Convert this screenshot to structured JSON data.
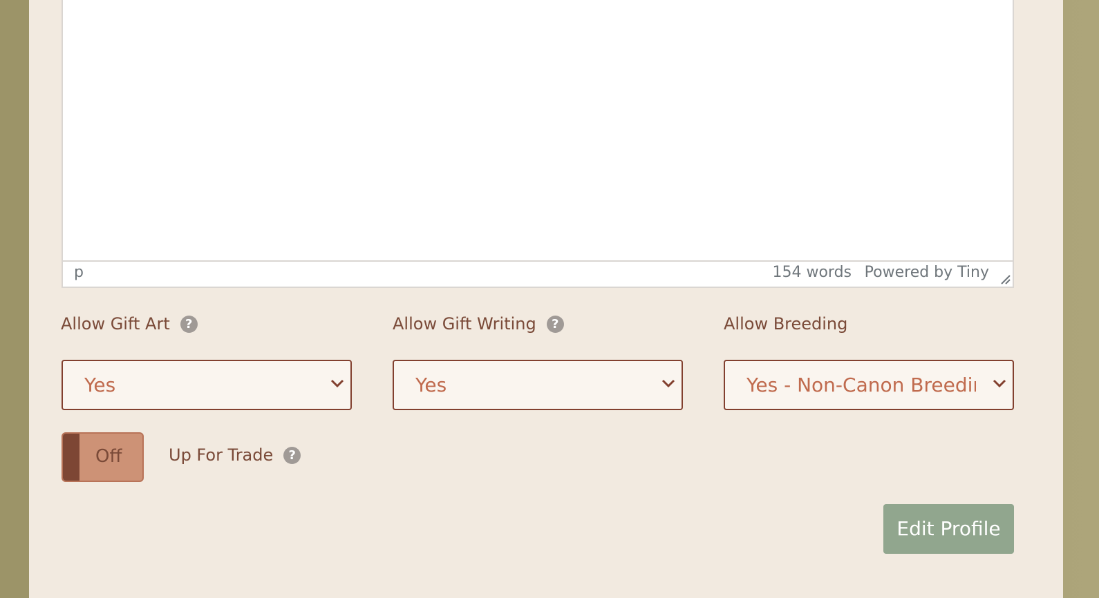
{
  "editor": {
    "status_path": "p",
    "word_count": "154 words",
    "powered_by": "Powered by Tiny"
  },
  "fields": {
    "gift_art": {
      "label": "Allow Gift Art",
      "help_glyph": "?",
      "value": "Yes"
    },
    "gift_writing": {
      "label": "Allow Gift Writing",
      "help_glyph": "?",
      "value": "Yes"
    },
    "breeding": {
      "label": "Allow Breeding",
      "value": "Yes - Non-Canon Breedings"
    }
  },
  "trade": {
    "toggle_text": "Off",
    "label": "Up For Trade",
    "help_glyph": "?"
  },
  "submit": {
    "label": "Edit Profile"
  },
  "colors": {
    "accent_border": "#82402f",
    "select_text": "#c06b4e",
    "label_text": "#7a4a38",
    "toggle_off": "#cd9276",
    "button_bg": "#91a68e"
  }
}
